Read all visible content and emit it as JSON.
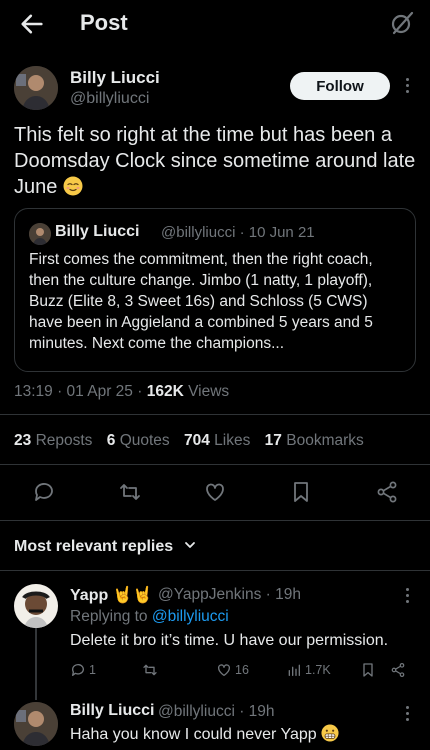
{
  "header": {
    "title": "Post",
    "icon_back": "back-arrow-icon",
    "icon_grok": "grok-icon"
  },
  "post": {
    "author_name": "Billy Liucci",
    "author_handle": "@billyliucci",
    "follow_label": "Follow",
    "text": "This felt so right at the time but has been a Doomsday Clock since sometime around late June",
    "emoji": "relieved-face-emoji",
    "quote": {
      "name": "Billy Liucci",
      "meta": "@billyliucci · 10 Jun 21",
      "text": "First comes the commitment, then the right coach, then the culture change. Jimbo (1 natty, 1 playoff), Buzz (Elite 8, 3 Sweet 16s) and Schloss (5 CWS) have been in Aggieland a combined 5 years and 5 minutes. Next come the champions..."
    },
    "time": "13:19 · 01 Apr 25 · ",
    "views_count": "162K",
    "views_label": " Views",
    "stats": {
      "reposts_count": "23",
      "reposts_label": "Reposts",
      "quotes_count": "6",
      "quotes_label": "Quotes",
      "likes_count": "704",
      "likes_label": "Likes",
      "bookmarks_count": "17",
      "bookmarks_label": "Bookmarks"
    }
  },
  "replies_header": "Most relevant replies",
  "replies": [
    {
      "name": "Yapp 🤘🤘",
      "handle": "@YappJenkins · 19h",
      "replying_prefix": "Replying to ",
      "replying_to": "@billyliucci",
      "text": "Delete it bro it’s time. U have our permission.",
      "reply_count": "1",
      "like_count": "16",
      "view_count": "1.7K"
    },
    {
      "name": "Billy Liucci",
      "handle": "@billyliucci · 19h",
      "text": "Haha you know I could never Yapp"
    }
  ],
  "colors": {
    "background": "#000000",
    "text": "#e7e9ea",
    "muted": "#71767b",
    "link": "#1d9bf0",
    "divider": "#2f3336"
  }
}
